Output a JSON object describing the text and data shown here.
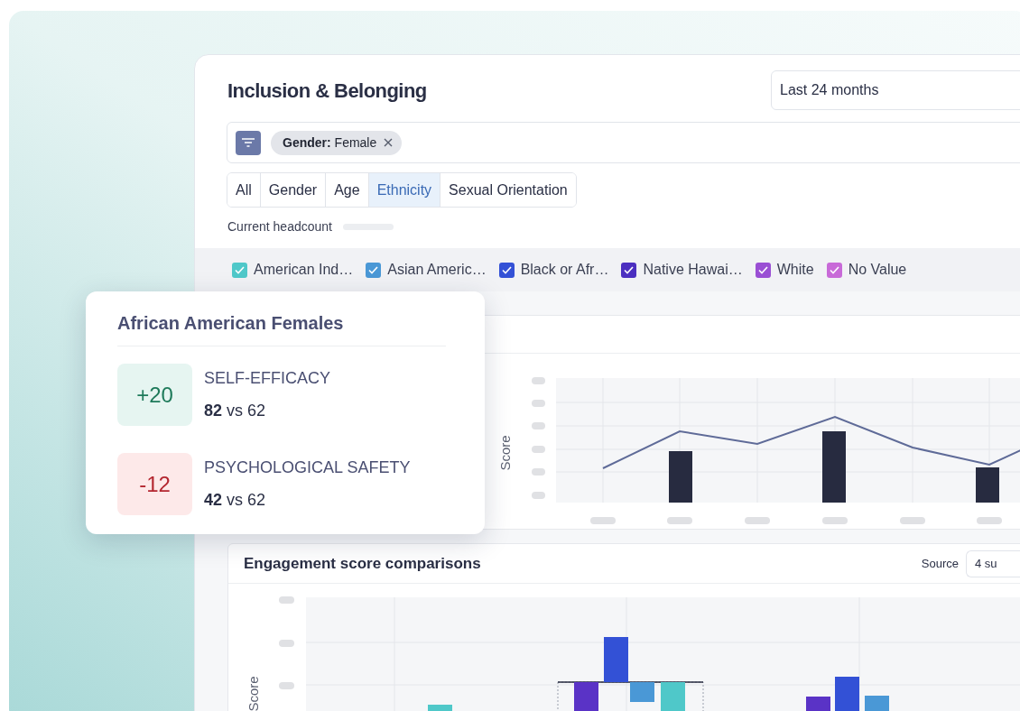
{
  "page": {
    "title": "Inclusion & Belonging",
    "period_select": {
      "value": "Last 24 months"
    }
  },
  "filter_chips": [
    {
      "text": "**Gender:** Female"
    }
  ],
  "tabs": [
    {
      "label": "All",
      "selected": false
    },
    {
      "label": "Gender",
      "selected": false
    },
    {
      "label": "Age",
      "selected": false
    },
    {
      "label": "Ethnicity",
      "selected": true
    },
    {
      "label": "Sexual Orientation",
      "selected": false
    }
  ],
  "headcount_label": "Current headcount",
  "legend": [
    {
      "label": "American Ind…",
      "checked": true,
      "color": "#4fc8c9"
    },
    {
      "label": "Asian Americ…",
      "checked": true,
      "color": "#4a98d6"
    },
    {
      "label": "Black or Afr…",
      "checked": true,
      "color": "#3351d6"
    },
    {
      "label": "Native Hawai…",
      "checked": true,
      "color": "#4b2fc0"
    },
    {
      "label": "White",
      "checked": true,
      "color": "#9a4fd4"
    },
    {
      "label": "No Value",
      "checked": true,
      "color": "#c86ad8"
    }
  ],
  "trend_chart": {
    "ylabel": "Score"
  },
  "tooltip": {
    "title": "African American Females",
    "metrics": [
      {
        "delta": "+20",
        "kind": "gain",
        "name": "SELF-EFFICACY",
        "comparison": "**82** vs 62"
      },
      {
        "delta": "-12",
        "kind": "loss",
        "name": "PSYCHOLOGICAL SAFETY",
        "comparison": "**42** vs 62"
      }
    ]
  },
  "engagement": {
    "title": "Engagement score comparisons",
    "source_label": "Source",
    "source_value": "4 su",
    "ylabel": "Score"
  }
}
